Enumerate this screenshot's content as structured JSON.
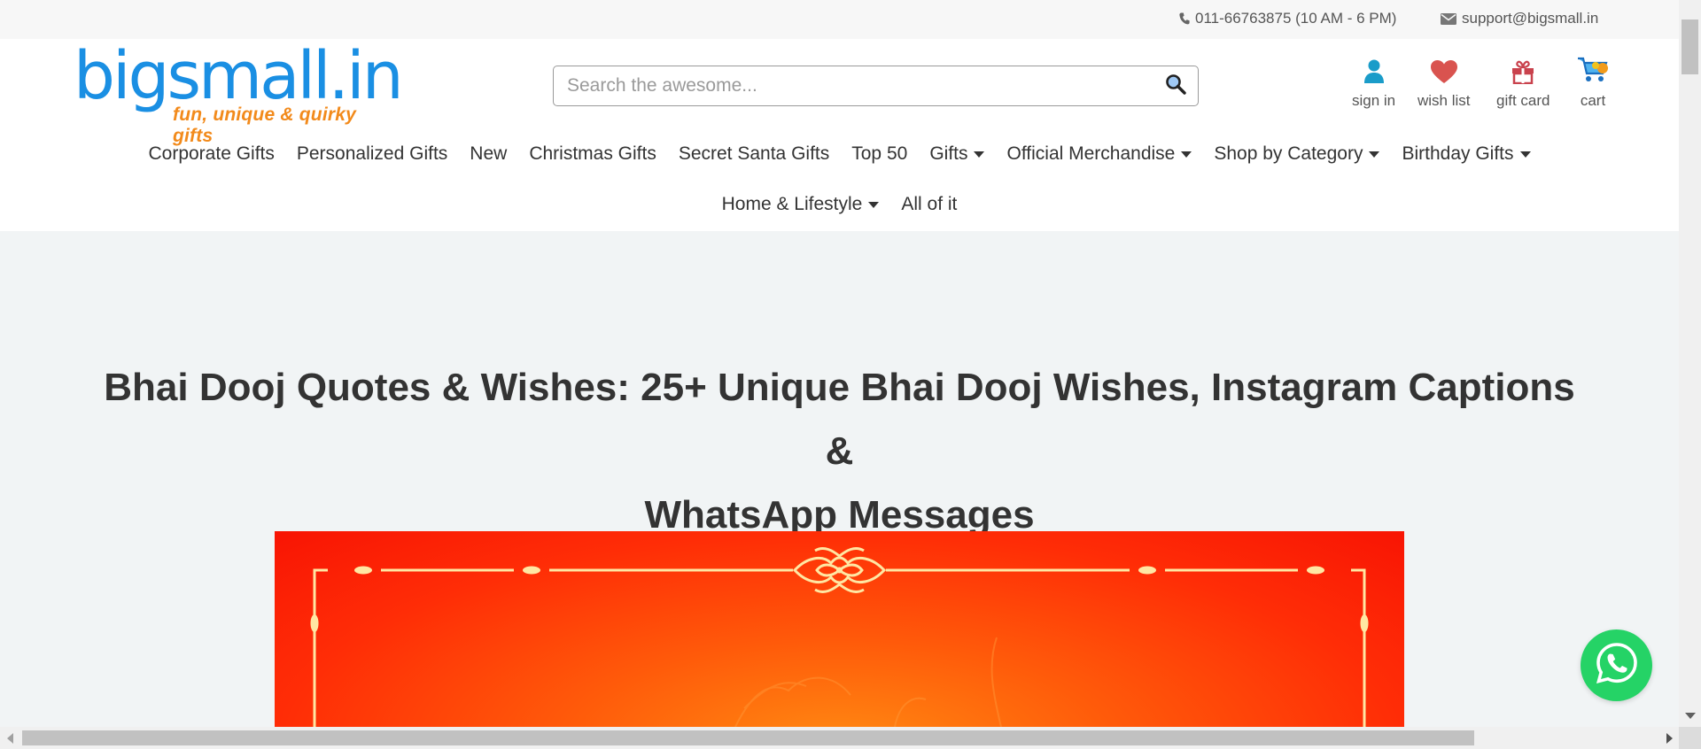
{
  "topbar": {
    "phone": "011-66763875 (10 AM - 6 PM)",
    "email": "support@bigsmall.in",
    "icons": [
      "phone-icon",
      "mail-icon"
    ]
  },
  "logo": {
    "name": "bigsmall.in",
    "tagline": "fun, unique & quirky gifts",
    "colors": {
      "main": "#1a8fe3",
      "tagline": "#f28a1b"
    }
  },
  "search": {
    "placeholder": "Search the awesome...",
    "value": "",
    "icon": "search-icon"
  },
  "user_nav": [
    {
      "label": "sign in",
      "icon": "user-icon",
      "color": "#1a9cc9"
    },
    {
      "label": "wish list",
      "icon": "heart-icon",
      "color": "#d9534f"
    },
    {
      "label": "gift card",
      "icon": "gift-icon",
      "color": "#c9424d"
    },
    {
      "label": "cart",
      "icon": "cart-icon",
      "color": "#1a8fe3"
    }
  ],
  "menu": {
    "row1": [
      {
        "label": "Corporate Gifts",
        "dropdown": false
      },
      {
        "label": "Personalized Gifts",
        "dropdown": false
      },
      {
        "label": "New",
        "dropdown": false
      },
      {
        "label": "Christmas Gifts",
        "dropdown": false
      },
      {
        "label": "Secret Santa Gifts",
        "dropdown": false
      },
      {
        "label": "Top 50",
        "dropdown": false
      },
      {
        "label": "Gifts",
        "dropdown": true
      },
      {
        "label": "Official Merchandise",
        "dropdown": true
      },
      {
        "label": "Shop by Category",
        "dropdown": true
      },
      {
        "label": "Birthday Gifts",
        "dropdown": true
      }
    ],
    "row2": [
      {
        "label": "Home & Lifestyle",
        "dropdown": true
      },
      {
        "label": "All of it",
        "dropdown": false
      }
    ]
  },
  "article": {
    "title_line1": "Bhai Dooj Quotes & Wishes: 25+ Unique Bhai Dooj Wishes, Instagram Captions &",
    "title_line2": "WhatsApp Messages",
    "hero_colors": [
      "#f81404",
      "#ff2d06",
      "#ff8a12"
    ]
  },
  "floating": {
    "whatsapp_icon": "whatsapp-icon",
    "color": "#25d366"
  }
}
